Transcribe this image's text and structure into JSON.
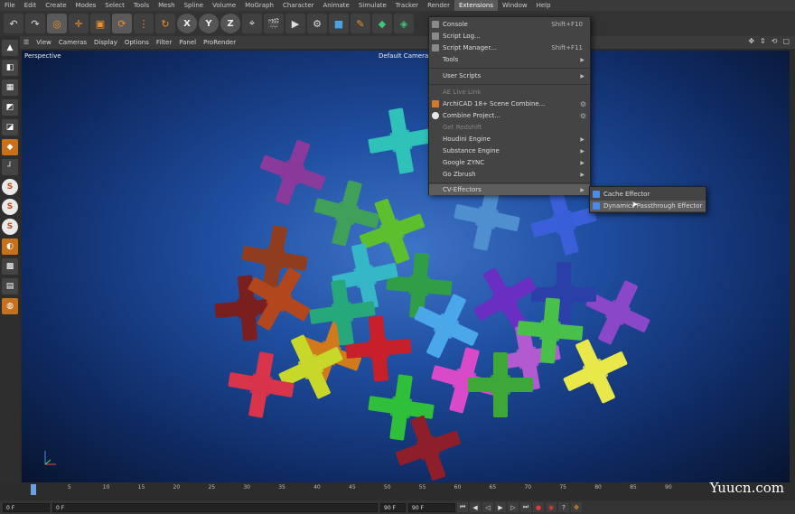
{
  "menubar": {
    "items": [
      "File",
      "Edit",
      "Create",
      "Modes",
      "Select",
      "Tools",
      "Mesh",
      "Spline",
      "Volume",
      "MoGraph",
      "Character",
      "Animate",
      "Simulate",
      "Tracker",
      "Render",
      "Extensions",
      "Window",
      "Help"
    ],
    "active": "Extensions"
  },
  "toolbar": {
    "axis_x": "X",
    "axis_y": "Y",
    "axis_z": "Z"
  },
  "viewport_menu": {
    "items": [
      "View",
      "Cameras",
      "Display",
      "Options",
      "Filter",
      "Panel",
      "ProRender"
    ]
  },
  "viewport": {
    "name": "Perspective",
    "camera": "Default Camera"
  },
  "extensions_menu": {
    "items": [
      {
        "label": "Console",
        "shortcut": "Shift+F10",
        "icon_color": "#8a8a8a"
      },
      {
        "label": "Script Log...",
        "shortcut": "",
        "icon_color": "#8a8a8a"
      },
      {
        "label": "Script Manager...",
        "shortcut": "Shift+F11",
        "icon_color": "#8a8a8a"
      },
      {
        "label": "Tools",
        "shortcut": "",
        "icon_color": ""
      },
      {
        "label": "User Scripts",
        "shortcut": "",
        "icon_color": ""
      },
      {
        "label": "AE Live Link",
        "shortcut": "",
        "icon_color": ""
      },
      {
        "label": "ArchiCAD 18+ Scene Combine...",
        "shortcut": "",
        "icon_color": "#d07a2a"
      },
      {
        "label": "Combine Project...",
        "shortcut": "",
        "icon_color": "#e8e8e8"
      },
      {
        "label": "Get Redshift",
        "shortcut": "",
        "icon_color": ""
      },
      {
        "label": "Houdini Engine",
        "shortcut": "",
        "icon_color": ""
      },
      {
        "label": "Substance Engine",
        "shortcut": "",
        "icon_color": ""
      },
      {
        "label": "Google ZYNC",
        "shortcut": "",
        "icon_color": ""
      },
      {
        "label": "Go Zbrush",
        "shortcut": "",
        "icon_color": ""
      },
      {
        "label": "CV-Effectors",
        "shortcut": "",
        "icon_color": ""
      }
    ]
  },
  "submenu": {
    "items": [
      {
        "label": "Cache Effector"
      },
      {
        "label": "Dynamics Passthrough Effector"
      }
    ]
  },
  "timeline": {
    "ticks": [
      "0",
      "5",
      "10",
      "15",
      "20",
      "25",
      "30",
      "35",
      "40",
      "45",
      "50",
      "55",
      "60",
      "65",
      "70",
      "75",
      "80",
      "85",
      "90"
    ]
  },
  "controls": {
    "start_frame": "0 F",
    "current_frame": "0 F",
    "end_frame": "90 F",
    "end_frame2": "90 F"
  },
  "watermark": "Yuucn.com",
  "colors": {
    "accent": "#f0902a",
    "viewport_center": "#3e74c8",
    "menu_bg": "#444444",
    "highlight": "#5d5d5d"
  }
}
